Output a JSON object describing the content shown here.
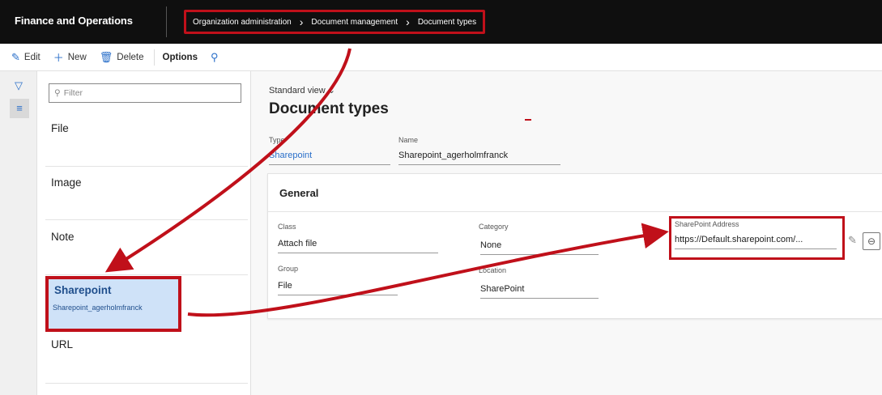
{
  "app": {
    "title": "Finance and Operations"
  },
  "breadcrumb": {
    "item1": "Organization administration",
    "item2": "Document management",
    "item3": "Document types"
  },
  "actions": {
    "edit": "Edit",
    "new": "New",
    "delete": "Delete",
    "options": "Options"
  },
  "list": {
    "filter_placeholder": "Filter",
    "items": [
      {
        "title": "File"
      },
      {
        "title": "Image"
      },
      {
        "title": "Note"
      },
      {
        "title": "Sharepoint",
        "subtitle": "Sharepoint_agerholmfranck"
      },
      {
        "title": "URL"
      }
    ]
  },
  "details": {
    "view_label": "Standard view",
    "title": "Document types",
    "type_label": "Type",
    "type_value": "Sharepoint",
    "name_label": "Name",
    "name_value": "Sharepoint_agerholmfranck",
    "general": {
      "header": "General",
      "class_label": "Class",
      "class_value": "Attach file",
      "category_label": "Category",
      "category_value": "None",
      "group_label": "Group",
      "group_value": "File",
      "location_label": "Location",
      "location_value": "SharePoint",
      "sharepoint_address_label": "SharePoint Address",
      "sharepoint_address_value": "https://Default.sharepoint.com/..."
    }
  },
  "colors": {
    "topbar": "#0f0f0f",
    "highlight": "#c0101a",
    "accent": "#2a6fc9",
    "selected_row": "#cfe2f8"
  }
}
